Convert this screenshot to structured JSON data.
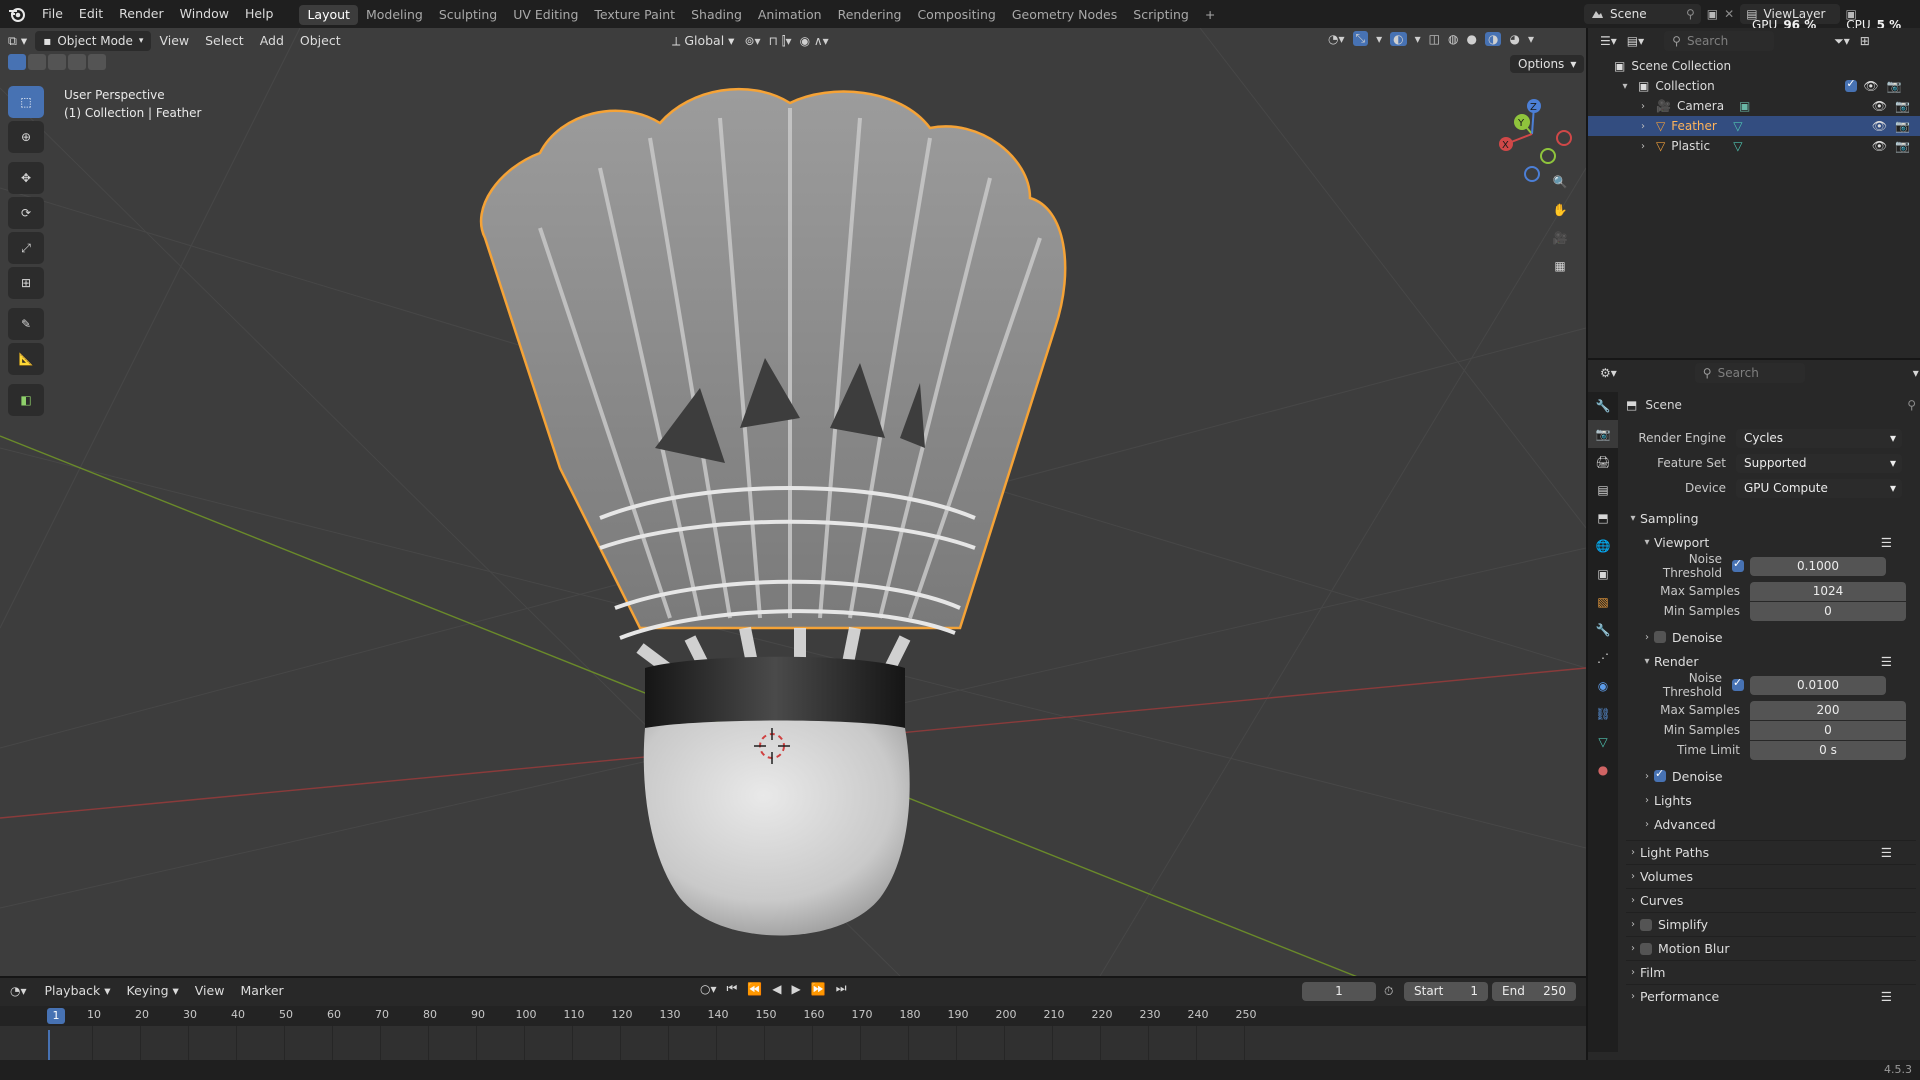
{
  "menubar": {
    "menus": [
      "File",
      "Edit",
      "Render",
      "Window",
      "Help"
    ],
    "workspaces": [
      "Layout",
      "Modeling",
      "Sculpting",
      "UV Editing",
      "Texture Paint",
      "Shading",
      "Animation",
      "Rendering",
      "Compositing",
      "Geometry Nodes",
      "Scripting"
    ],
    "active_workspace": "Layout",
    "add_tab": "+",
    "scene": "Scene",
    "view_layer": "ViewLayer",
    "gpu_label": "GPU",
    "gpu_value": "96 %",
    "cpu_label": "CPU",
    "cpu_value": "5 %"
  },
  "viewport": {
    "mode": "Object Mode",
    "menus": [
      "View",
      "Select",
      "Add",
      "Object"
    ],
    "orientation": "Global",
    "options": "Options",
    "overlay_title": "User Perspective",
    "overlay_subtitle": "(1) Collection | Feather",
    "gizmo": {
      "x": "X",
      "y": "Y",
      "z": "Z"
    }
  },
  "outliner": {
    "search_placeholder": "Search",
    "scene_collection": "Scene Collection",
    "collection": "Collection",
    "items": [
      {
        "label": "Camera",
        "selected": false
      },
      {
        "label": "Feather",
        "selected": true
      },
      {
        "label": "Plastic",
        "selected": false
      }
    ]
  },
  "properties": {
    "search_placeholder": "Search",
    "context": "Scene",
    "render_engine_label": "Render Engine",
    "render_engine": "Cycles",
    "feature_set_label": "Feature Set",
    "feature_set": "Supported",
    "device_label": "Device",
    "device": "GPU Compute",
    "sampling": "Sampling",
    "viewport": {
      "title": "Viewport",
      "noise_threshold_label": "Noise Threshold",
      "noise_threshold": "0.1000",
      "max_samples_label": "Max Samples",
      "max_samples": "1024",
      "min_samples_label": "Min Samples",
      "min_samples": "0",
      "denoise": "Denoise"
    },
    "render": {
      "title": "Render",
      "noise_threshold_label": "Noise Threshold",
      "noise_threshold": "0.0100",
      "max_samples_label": "Max Samples",
      "max_samples": "200",
      "min_samples_label": "Min Samples",
      "min_samples": "0",
      "time_limit_label": "Time Limit",
      "time_limit": "0 s",
      "denoise": "Denoise"
    },
    "lights": "Lights",
    "advanced": "Advanced",
    "panels": [
      "Light Paths",
      "Volumes",
      "Curves",
      "Simplify",
      "Motion Blur",
      "Film",
      "Performance"
    ]
  },
  "timeline": {
    "menus": [
      "Playback",
      "Keying",
      "View",
      "Marker"
    ],
    "current_frame": "1",
    "start_label": "Start",
    "start": "1",
    "end_label": "End",
    "end": "250",
    "ticks": [
      "10",
      "20",
      "30",
      "40",
      "50",
      "60",
      "70",
      "80",
      "90",
      "100",
      "110",
      "120",
      "130",
      "140",
      "150",
      "160",
      "170",
      "180",
      "190",
      "200",
      "210",
      "220",
      "230",
      "240",
      "250"
    ],
    "playhead": "1"
  },
  "status": {
    "version": "4.5.3"
  },
  "colors": {
    "accent": "#4772b3",
    "selection": "#f5a337",
    "background": "#3d3d3d"
  }
}
